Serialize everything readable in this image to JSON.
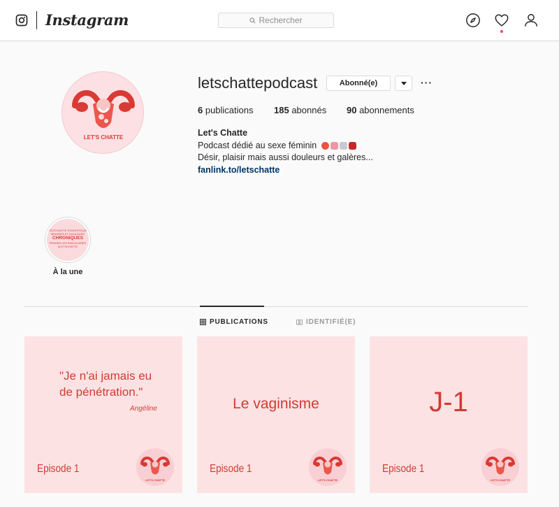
{
  "header": {
    "wordmark": "Instagram",
    "search_placeholder": "Rechercher",
    "icons": [
      "instagram-glyph-icon",
      "search-icon",
      "compass-icon",
      "heart-icon",
      "user-icon"
    ]
  },
  "profile": {
    "username": "letschattepodcast",
    "follow_button": "Abonné(e)",
    "more_glyph": "···",
    "stats": {
      "publications_count": "6",
      "publications_label": "publications",
      "followers_count": "185",
      "followers_label": "abonnés",
      "following_count": "90",
      "following_label": "abonnements"
    },
    "bio": {
      "name": "Let's Chatte",
      "line1": "Podcast dédié au sexe féminin",
      "line2": "Désir, plaisir mais aussi douleurs et galères...",
      "link": "fanlink.to/letschatte"
    },
    "avatar_text": "LET'S CHATTE"
  },
  "highlight": {
    "label": "À la une",
    "thumb_small1": "TÉLÉCHATTE S'INVESTIGUE",
    "thumb_small2": "MINORES ET DOULEURS",
    "thumb_big": "CHRONIQUES",
    "thumb_small3": "PENSER LES ENDOLORIES",
    "thumb_small4": "#LETSCHATTE"
  },
  "tabs": [
    {
      "label": "PUBLICATIONS",
      "active": true,
      "icon": "grid-icon"
    },
    {
      "label": "IDENTIFIÉ(E)",
      "active": false,
      "icon": "tag-icon"
    }
  ],
  "posts": [
    {
      "quote_line1": "\"Je n'ai jamais eu",
      "quote_line2": "de pénétration.\"",
      "author": "Angéline",
      "episode": "Episode 1",
      "logo_text": "LET'S CHATTE"
    },
    {
      "title": "Le vaginisme",
      "episode": "Episode 1",
      "logo_text": "LET'S CHATTE"
    },
    {
      "title": "J-1",
      "episode": "Episode 1",
      "logo_text": "LET'S CHATTE"
    }
  ],
  "colors": {
    "accent_red": "#d03c32",
    "post_pink": "#fde2e4",
    "link_blue": "#003569",
    "notification_red": "#ed4956"
  }
}
